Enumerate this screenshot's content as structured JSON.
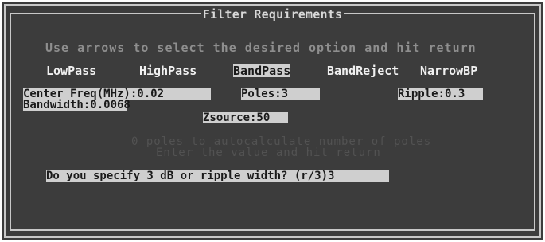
{
  "window": {
    "title": "Filter Requirements"
  },
  "instructions": "Use arrows to select the desired option and hit return",
  "filter_types": [
    {
      "label": "LowPass",
      "selected": false
    },
    {
      "label": "HighPass",
      "selected": false
    },
    {
      "label": "BandPass",
      "selected": true
    },
    {
      "label": "BandReject",
      "selected": false
    },
    {
      "label": "NarrowBP",
      "selected": false
    }
  ],
  "fields": {
    "center_freq": "Center Freq(MHz):0.02",
    "poles": "Poles:3",
    "ripple": "Ripple:0.3",
    "bandwidth": "Bandwidth:0.0068",
    "zsource": "Zsource:50"
  },
  "hints": {
    "line1": "0 poles to autocalculate number of poles",
    "line2": "Enter the value and hit return"
  },
  "prompt": "Do you specify 3 dB or ripple width? (r/3)3",
  "colors": {
    "background": "#3c3c3c",
    "highlight": "#cfcfcf",
    "text": "#f0f0f0",
    "dim_text": "#8e8e8e",
    "hint_text": "#525252"
  }
}
